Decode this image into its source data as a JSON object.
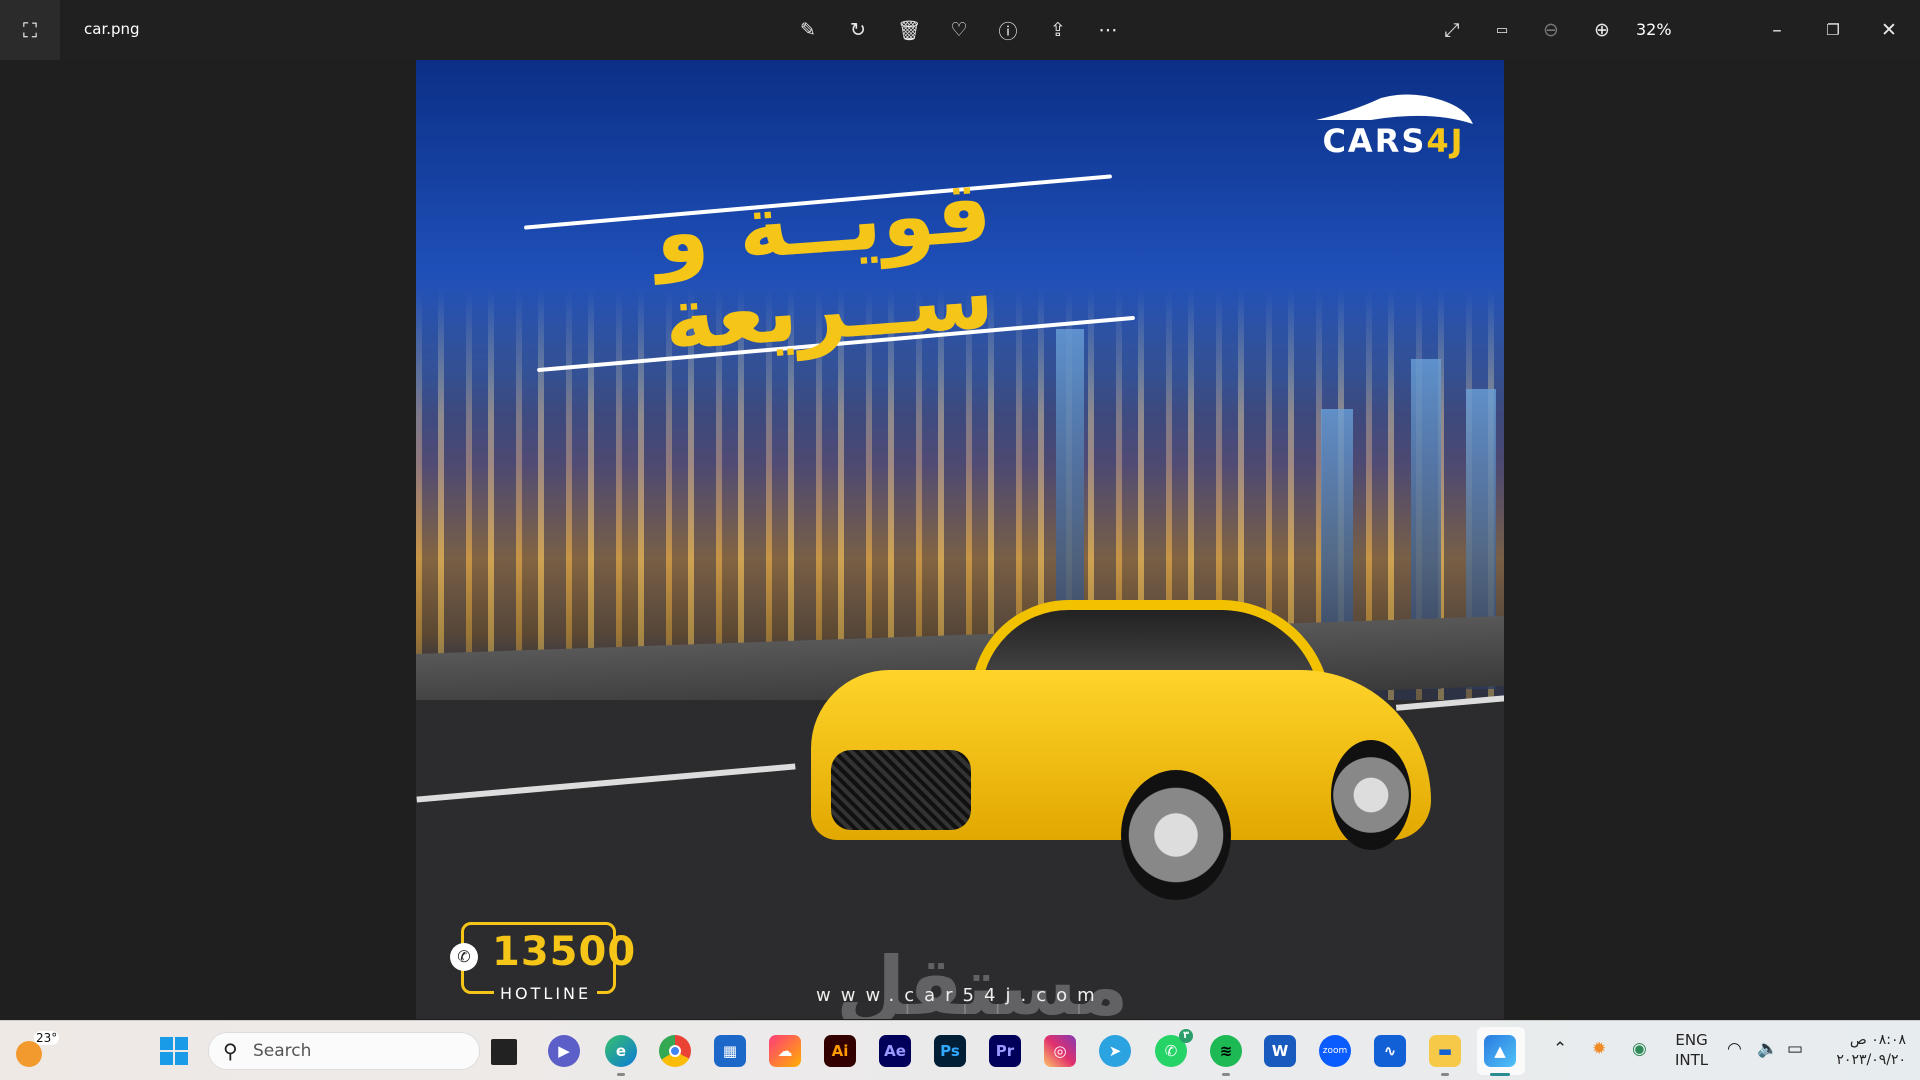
{
  "window": {
    "title": "car.png",
    "zoom_level": "32%"
  },
  "toolbar": {
    "items": [
      "edit-image-icon",
      "rotate-icon",
      "delete-icon",
      "favorite-icon",
      "info-icon",
      "share-icon",
      "more-icon"
    ],
    "right": [
      "fullscreen-icon",
      "actual-size-icon",
      "zoom-out-icon",
      "zoom-in-icon"
    ]
  },
  "image": {
    "headline": "قويــة  و ســريعة",
    "logo": {
      "main": "CARS",
      "accent": "4J"
    },
    "hotline": {
      "number": "13500",
      "label": "HOTLINE"
    },
    "website": "www.car54j.com",
    "watermark": "مستقل",
    "accent_color": "#f5c518",
    "sky_color": "#0b2f86"
  },
  "taskbar": {
    "weather_temp": "23°",
    "search_placeholder": "Search",
    "apps": [
      {
        "name": "Ai",
        "color": "#330000",
        "fg": "#ff9a00"
      },
      {
        "name": "Ae",
        "color": "#00005b",
        "fg": "#9999ff"
      },
      {
        "name": "Ps",
        "color": "#001e36",
        "fg": "#31a8ff"
      },
      {
        "name": "Pr",
        "color": "#00005b",
        "fg": "#9999ff"
      }
    ],
    "zoom_label": "zoom",
    "whatsapp_badge": "٣"
  },
  "tray": {
    "lang1": "ENG",
    "lang2": "INTL",
    "time": "٠٨:٠٨ ص",
    "date": "٢٠٢٣/٠٩/٢٠"
  }
}
